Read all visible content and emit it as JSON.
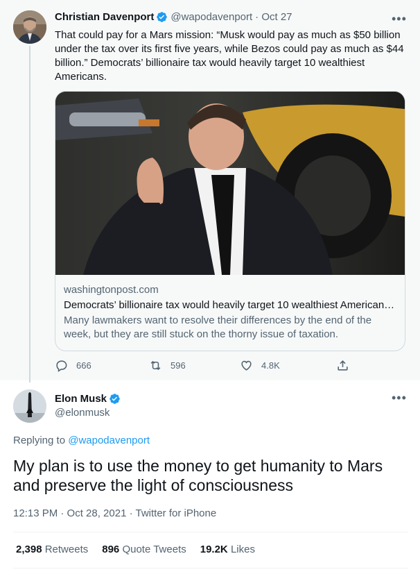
{
  "parent_tweet": {
    "author_name": "Christian Davenport",
    "handle": "@wapodavenport",
    "date": "· Oct 27",
    "text": "That could pay for a Mars mission: “Musk would pay as much as $50 billion under the tax over its first five years, while Bezos could pay as much as $44 billion.” Democrats’ billionaire tax would heavily target 10 wealthiest Americans.",
    "more": "•••",
    "card": {
      "domain": "washingtonpost.com",
      "title": "Democrats’ billionaire tax would heavily target 10 wealthiest American…",
      "description": "Many lawmakers want to resolve their differences by the end of the week, but they are still stuck on the thorny issue of taxation."
    },
    "actions": {
      "replies": "666",
      "retweets": "596",
      "likes": "4.8K"
    }
  },
  "main_tweet": {
    "author_name": "Elon Musk",
    "handle": "@elonmusk",
    "more": "•••",
    "replying_prefix": "Replying to",
    "replying_to": "@wapodavenport",
    "text": "My plan is to use the money to get humanity to Mars and preserve the light of consciousness",
    "timestamp": "12:13 PM · Oct 28, 2021 · Twitter for iPhone",
    "stats": {
      "retweets_count": "2,398",
      "retweets_label": "Retweets",
      "quotes_count": "896",
      "quotes_label": "Quote Tweets",
      "likes_count": "19.2K",
      "likes_label": "Likes"
    }
  },
  "colors": {
    "accent": "#1d9bf0",
    "muted_text": "#536471",
    "parent_bg": "#f7f9f9"
  },
  "icons": [
    "verified-badge-icon",
    "more-icon",
    "reply-icon",
    "retweet-icon",
    "like-icon",
    "share-icon"
  ]
}
